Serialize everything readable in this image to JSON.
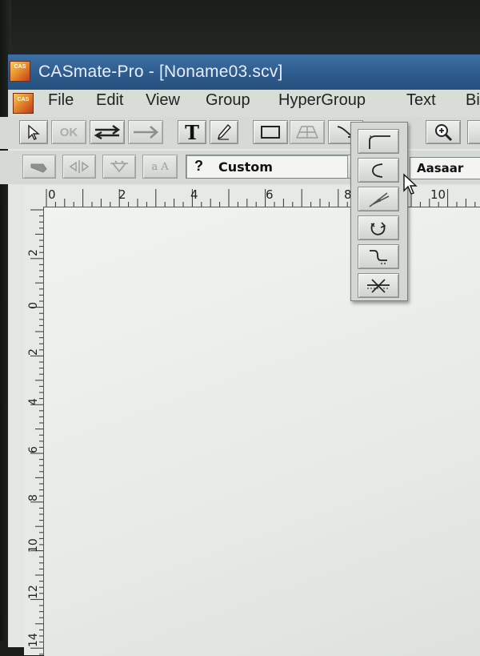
{
  "window": {
    "title": "CASmate-Pro - [Noname03.scv]",
    "app_icon_text": "CAS"
  },
  "menu": [
    "File",
    "Edit",
    "View",
    "Group",
    "HyperGroup",
    "Text",
    "Bi"
  ],
  "toolbar1": [
    {
      "name": "select-arrow-icon",
      "enabled": true
    },
    {
      "name": "ok-icon",
      "enabled": false,
      "label": "OK"
    },
    {
      "name": "swap-arrows-icon",
      "enabled": true
    },
    {
      "name": "right-arrow-icon",
      "enabled": false
    },
    {
      "name": "text-tool-icon",
      "enabled": true,
      "label": "T"
    },
    {
      "name": "pencil-icon",
      "enabled": true
    },
    {
      "name": "rectangle-icon",
      "enabled": true
    },
    {
      "name": "perspective-icon",
      "enabled": false
    },
    {
      "name": "curve-tool-icon",
      "enabled": true
    },
    {
      "name": "zoom-in-icon",
      "enabled": true
    }
  ],
  "toolbar2": [
    {
      "name": "node-tool-icon",
      "enabled": false
    },
    {
      "name": "mirror-icon",
      "enabled": false
    },
    {
      "name": "weld-icon",
      "enabled": false
    },
    {
      "name": "text-spacing-icon",
      "enabled": false,
      "label": "a A"
    }
  ],
  "style_combo": {
    "prefix": "?",
    "value": "Custom"
  },
  "font_preview": "Aasaar",
  "ruler_h": [
    "0",
    "2",
    "4",
    "6",
    "8",
    "10"
  ],
  "ruler_v": [
    "2",
    "0",
    "2",
    "4",
    "6",
    "8",
    "10",
    "12",
    "14"
  ],
  "flyout_tools": [
    "fillet-corner-icon",
    "arc-tool-icon",
    "tangent-line-icon",
    "rotate-point-icon",
    "offset-curve-icon",
    "trim-cross-icon"
  ],
  "colors": {
    "titlebar": "#2d5a8c",
    "face": "#d6dad5",
    "canvas": "#eceee9"
  }
}
